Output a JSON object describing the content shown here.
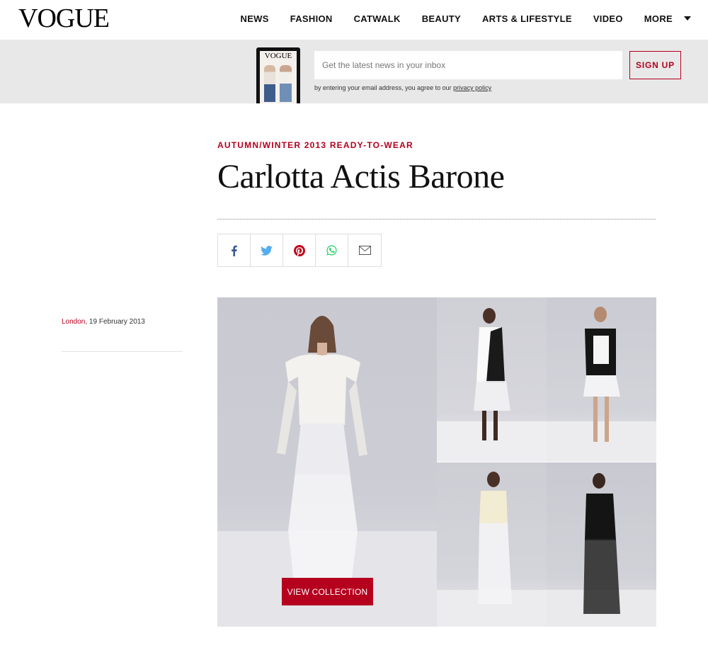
{
  "brand": {
    "logo_text": "VOGUE"
  },
  "nav": {
    "items": [
      "NEWS",
      "FASHION",
      "CATWALK",
      "BEAUTY",
      "ARTS & LIFESTYLE",
      "VIDEO"
    ],
    "more_label": "MORE"
  },
  "newsletter": {
    "magazine_logo": "VOGUE",
    "placeholder": "Get the latest news in your inbox",
    "signup_label": "SIGN UP",
    "consent_text": "by entering your email address, you agree to our ",
    "privacy_link": "privacy policy"
  },
  "article": {
    "kicker": "AUTUMN/WINTER 2013 READY-TO-WEAR",
    "title": "Carlotta Actis Barone",
    "location": "London",
    "date": ", 19 February 2013"
  },
  "share": {
    "icons": [
      "facebook-icon",
      "twitter-icon",
      "pinterest-icon",
      "whatsapp-icon",
      "email-icon"
    ],
    "colors": {
      "facebook": "#3b5998",
      "twitter": "#55acee",
      "pinterest": "#bd081c",
      "whatsapp": "#25d366",
      "email": "#555555"
    }
  },
  "gallery": {
    "view_label": "VIEW COLLECTION"
  },
  "colors": {
    "accent": "#b5001e",
    "band": "#e8e8e8"
  }
}
